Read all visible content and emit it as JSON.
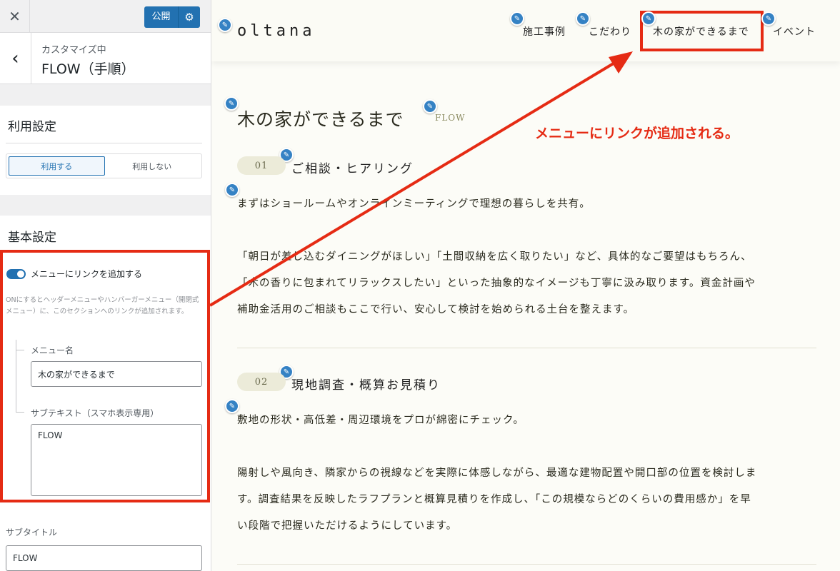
{
  "customizer": {
    "close_icon": "close-icon",
    "publish_label": "公開",
    "publish_settings_icon": "gear-icon",
    "back_icon": "chevron-left-icon",
    "breadcrumb": "カスタマイズ中",
    "section_title": "FLOW（手順）",
    "usage": {
      "heading": "利用設定",
      "options": [
        "利用する",
        "利用しない"
      ],
      "selected": "利用する"
    },
    "basic": {
      "heading": "基本設定",
      "menu_link_toggle_label": "メニューにリンクを追加する",
      "menu_link_toggle_on": true,
      "description": "ONにするとヘッダーメニューやハンバーガーメニュー（開閉式メニュー）に、このセクションへのリンクが追加されます。",
      "menu_name_label": "メニュー名",
      "menu_name_value": "木の家ができるまで",
      "subtext_label": "サブテキスト（スマホ表示専用）",
      "subtext_value": "FLOW"
    },
    "subtitle_label": "サブタイトル",
    "subtitle_value": "FLOW"
  },
  "preview": {
    "logo": "oltana",
    "nav": [
      "施工事例",
      "こだわり",
      "木の家ができるまで",
      "イベント"
    ],
    "section_title": "木の家ができるまで",
    "section_subtitle": "FLOW",
    "steps": [
      {
        "number": "01",
        "title": "ご相談・ヒアリング",
        "lines": [
          "まずはショールームやオンラインミーティングで理想の暮らしを共有。",
          "",
          "「朝日が差し込むダイニングがほしい」「土間収納を広く取りたい」など、具体的なご要望はもちろん、",
          "「木の香りに包まれてリラックスしたい」といった抽象的なイメージも丁寧に汲み取ります。資金計画や",
          "補助金活用のご相談もここで行い、安心して検討を始められる土台を整えます。"
        ]
      },
      {
        "number": "02",
        "title": "現地調査・概算お見積り",
        "lines": [
          "敷地の形状・高低差・周辺環境をプロが綿密にチェック。",
          "",
          "陽射しや風向き、隣家からの視線などを実際に体感しながら、最適な建物配置や開口部の位置を検討しま",
          "す。調査結果を反映したラフプランと概算見積りを作成し、「この規模ならどのくらいの費用感か」を早",
          "い段階で把握いただけるようにしています。"
        ]
      }
    ],
    "edit_icon": "pencil-icon"
  },
  "annotation": "メニューにリンクが追加される。",
  "colors": {
    "accent_blue": "#2271b1",
    "highlight_red": "#e52b14",
    "preview_bg": "#fcfcf7"
  }
}
